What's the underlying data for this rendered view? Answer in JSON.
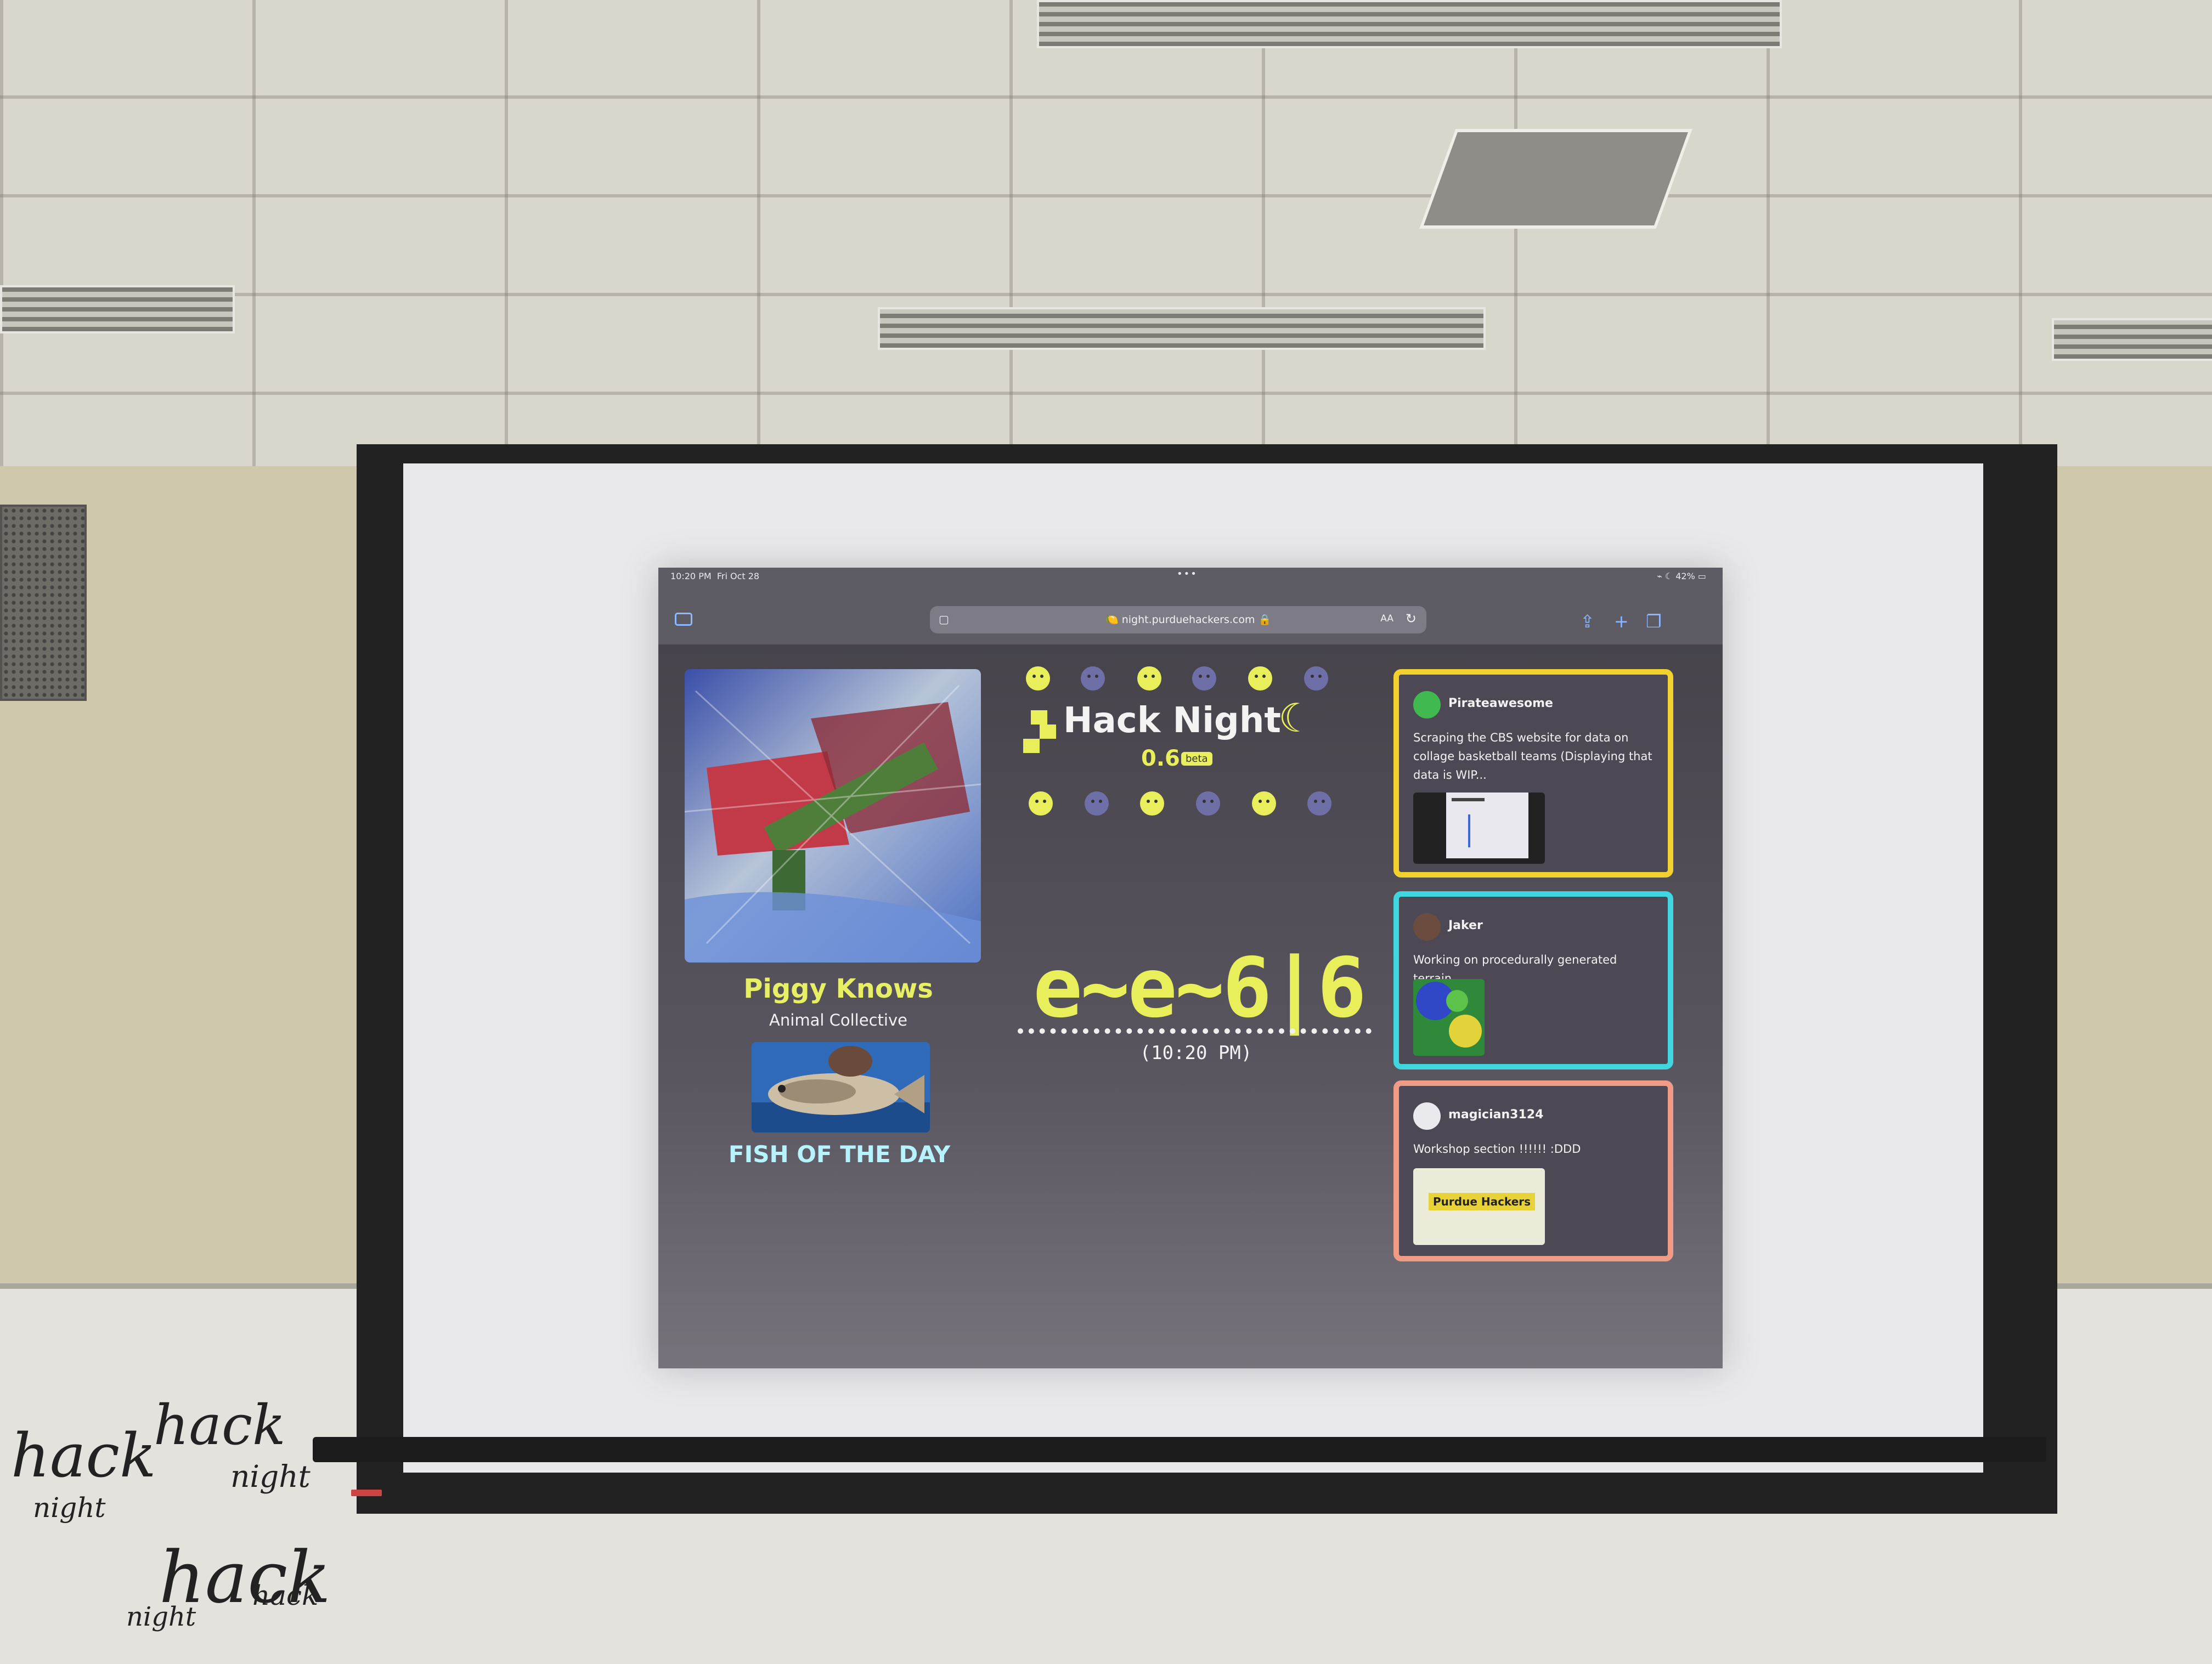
{
  "statusbar": {
    "time": "10:20 PM",
    "date": "Fri Oct 28",
    "battery": "42%",
    "dots": "•••"
  },
  "browser": {
    "url": "night.purduehackers.com",
    "text_size_label": "AA"
  },
  "now_playing": {
    "song": "Piggy Knows",
    "artist": "Animal Collective"
  },
  "fish": {
    "label": "FISH OF THE DAY"
  },
  "hack_night": {
    "title": "Hack Night",
    "version": "0.6",
    "badge": "beta",
    "countdown": "e~e~6|6",
    "clock": "(10:20 PM)"
  },
  "cards": [
    {
      "author": "Pirateawesome",
      "message": "Scraping the CBS website for data on collage basketball teams (Displaying that data is WIP...",
      "border_color": "#f2d12e"
    },
    {
      "author": "Jaker",
      "message": "Working on procedurally generated terrain",
      "border_color": "#3fd6df"
    },
    {
      "author": "magician3124",
      "message": "Workshop section !!!!!! :DDD",
      "border_color": "#ef9b86",
      "image_caption": "Purdue Hackers"
    }
  ],
  "whiteboard": {
    "words": [
      "hack",
      "night"
    ]
  }
}
